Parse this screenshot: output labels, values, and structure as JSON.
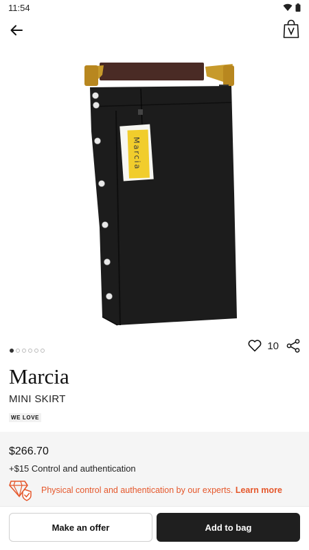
{
  "status": {
    "time": "11:54"
  },
  "gallery": {
    "total_images": 6,
    "active_index": 0
  },
  "likes": {
    "count": "10"
  },
  "product": {
    "brand": "Marcia",
    "type": "MINI SKIRT",
    "tag_label": "WE LOVE",
    "price": "$266.70",
    "fee_text": "+$15 Control and authentication",
    "auth_text": "Physical control and authentication by our experts.",
    "learn_more": "Learn more",
    "hang_tag_brand": "Marcia"
  },
  "actions": {
    "offer_label": "Make an offer",
    "add_label": "Add to bag"
  },
  "colors": {
    "accent": "#e5572b",
    "primary_button": "#1f1f1f",
    "panel": "#f5f5f5"
  },
  "icons": {
    "back": "arrow-left-icon",
    "bag": "shopping-bag-icon",
    "heart": "heart-icon",
    "share": "share-icon",
    "auth": "diamond-shield-icon",
    "wifi": "wifi-icon",
    "battery": "battery-icon"
  }
}
